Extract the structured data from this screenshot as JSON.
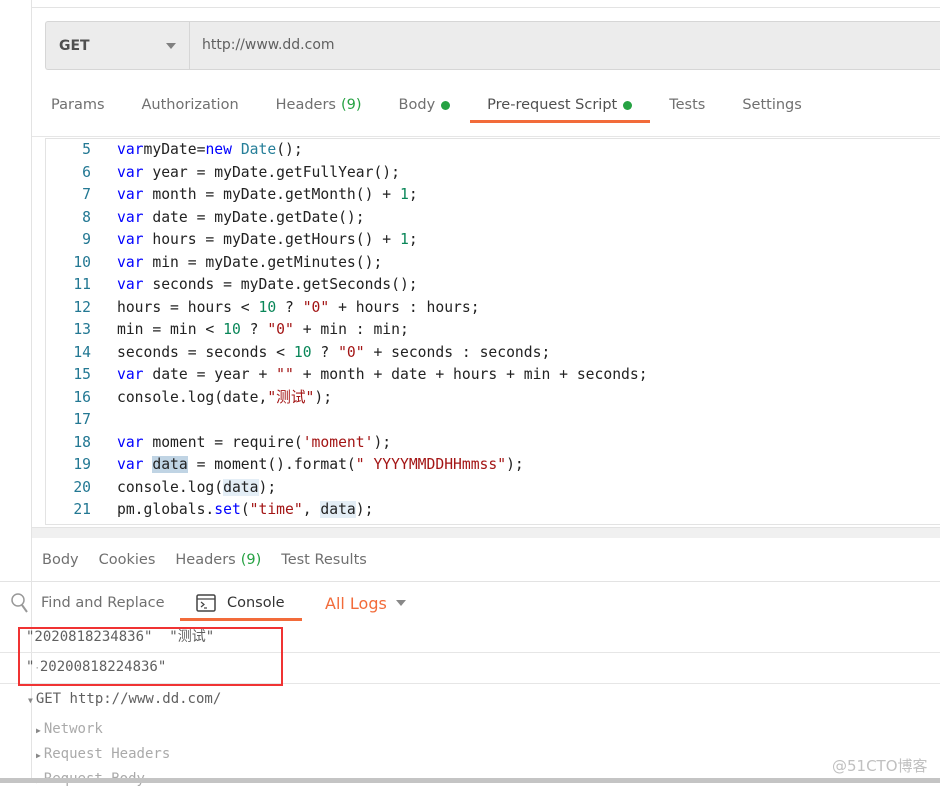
{
  "request": {
    "method": "GET",
    "url": "http://www.dd.com"
  },
  "request_tabs": [
    {
      "label": "Params"
    },
    {
      "label": "Authorization"
    },
    {
      "label": "Headers",
      "count": "(9)"
    },
    {
      "label": "Body",
      "dot": true
    },
    {
      "label": "Pre-request Script",
      "dot": true,
      "active": true
    },
    {
      "label": "Tests"
    },
    {
      "label": "Settings"
    }
  ],
  "editor": {
    "lines": [
      {
        "n": "5",
        "tokens": [
          [
            "kw",
            "var"
          ],
          [
            "",
            "myDate="
          ],
          [
            "kw",
            "new"
          ],
          [
            "",
            " "
          ],
          [
            "type",
            "Date"
          ],
          [
            "",
            "();"
          ]
        ]
      },
      {
        "n": "6",
        "tokens": [
          [
            "kw",
            "var"
          ],
          [
            "",
            " year = myDate.getFullYear();"
          ]
        ]
      },
      {
        "n": "7",
        "tokens": [
          [
            "kw",
            "var"
          ],
          [
            "",
            " month = myDate.getMonth() + "
          ],
          [
            "num",
            "1"
          ],
          [
            "",
            ";"
          ]
        ]
      },
      {
        "n": "8",
        "tokens": [
          [
            "kw",
            "var"
          ],
          [
            "",
            " date = myDate.getDate();"
          ]
        ]
      },
      {
        "n": "9",
        "tokens": [
          [
            "kw",
            "var"
          ],
          [
            "",
            " hours = myDate.getHours() + "
          ],
          [
            "num",
            "1"
          ],
          [
            "",
            ";"
          ]
        ]
      },
      {
        "n": "10",
        "tokens": [
          [
            "kw",
            "var"
          ],
          [
            "",
            " min = myDate.getMinutes();"
          ]
        ]
      },
      {
        "n": "11",
        "tokens": [
          [
            "kw",
            "var"
          ],
          [
            "",
            " seconds = myDate.getSeconds();"
          ]
        ]
      },
      {
        "n": "12",
        "tokens": [
          [
            "",
            "hours = hours < "
          ],
          [
            "num",
            "10"
          ],
          [
            "",
            " ? "
          ],
          [
            "str",
            "\"0\""
          ],
          [
            "",
            " + hours : hours;"
          ]
        ]
      },
      {
        "n": "13",
        "tokens": [
          [
            "",
            "min = min < "
          ],
          [
            "num",
            "10"
          ],
          [
            "",
            " ? "
          ],
          [
            "str",
            "\"0\""
          ],
          [
            "",
            " + min : min;"
          ]
        ]
      },
      {
        "n": "14",
        "tokens": [
          [
            "",
            "seconds = seconds < "
          ],
          [
            "num",
            "10"
          ],
          [
            "",
            " ? "
          ],
          [
            "str",
            "\"0\""
          ],
          [
            "",
            " + seconds : seconds;"
          ]
        ]
      },
      {
        "n": "15",
        "tokens": [
          [
            "kw",
            "var"
          ],
          [
            "",
            " date = year + "
          ],
          [
            "str",
            "\"\""
          ],
          [
            "",
            " + month + date + hours + min + seconds;"
          ]
        ]
      },
      {
        "n": "16",
        "tokens": [
          [
            "",
            "console.log(date,"
          ],
          [
            "str",
            "\"测试\""
          ],
          [
            "",
            ");"
          ]
        ]
      },
      {
        "n": "17",
        "tokens": []
      },
      {
        "n": "18",
        "tokens": [
          [
            "kw",
            "var"
          ],
          [
            "",
            " moment = require("
          ],
          [
            "str",
            "'moment'"
          ],
          [
            "",
            ");"
          ]
        ]
      },
      {
        "n": "19",
        "tokens": [
          [
            "kw",
            "var"
          ],
          [
            "",
            " "
          ],
          [
            "hl",
            "data"
          ],
          [
            "",
            " = moment().format("
          ],
          [
            "str",
            "\" YYYYMMDDHHmmss\""
          ],
          [
            "",
            ");"
          ]
        ]
      },
      {
        "n": "20",
        "tokens": [
          [
            "",
            "console.log("
          ],
          [
            "hl2",
            "data"
          ],
          [
            "",
            ");"
          ]
        ]
      },
      {
        "n": "21",
        "tokens": [
          [
            "",
            "pm.globals."
          ],
          [
            "kw",
            "set"
          ],
          [
            "",
            "("
          ],
          [
            "str",
            "\"time\""
          ],
          [
            "",
            ", "
          ],
          [
            "hl2",
            "data"
          ],
          [
            "",
            ");"
          ]
        ]
      }
    ]
  },
  "response_tabs": [
    {
      "label": "Body"
    },
    {
      "label": "Cookies"
    },
    {
      "label": "Headers",
      "count": "(9)"
    },
    {
      "label": "Test Results"
    }
  ],
  "console_bar": {
    "find_replace": "Find and Replace",
    "console": "Console",
    "all_logs": "All Logs"
  },
  "console": {
    "log1": "\"2020818234836\"  \"测试\"",
    "log2_prefix": "\"",
    "log2_space": "·",
    "log2_value": "20200818224836\"",
    "request_line": "GET http://www.dd.com/",
    "sections": [
      "Network",
      "Request Headers",
      "Request Body"
    ]
  },
  "watermark": "@51CTO博客",
  "colors": {
    "accent": "#f26b3a",
    "green": "#26a243",
    "highlight_box": "#f03333"
  }
}
